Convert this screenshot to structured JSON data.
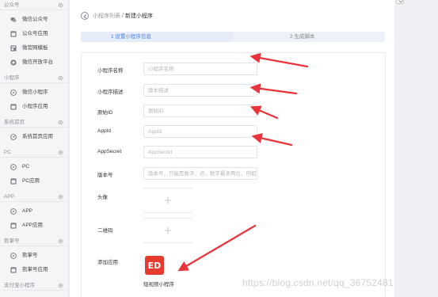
{
  "sidebar": {
    "groups": [
      {
        "title": "公众号",
        "items": [
          {
            "label": "微信公众号",
            "icon": "chat-bubble-icon"
          },
          {
            "label": "公众号应用",
            "icon": "app-window-icon"
          },
          {
            "label": "微官网模板",
            "icon": "template-icon"
          },
          {
            "label": "微信开放平台",
            "icon": "platform-icon"
          }
        ]
      },
      {
        "title": "小程序",
        "items": [
          {
            "label": "微信小程序",
            "icon": "compass-icon"
          },
          {
            "label": "小程序应用",
            "icon": "app-window-icon"
          }
        ]
      },
      {
        "title": "系统首页",
        "items": [
          {
            "label": "系统首页应用",
            "icon": "gauge-icon"
          }
        ]
      },
      {
        "title": "PC",
        "items": [
          {
            "label": "PC",
            "icon": "compass-icon"
          },
          {
            "label": "PC应用",
            "icon": "app-window-icon"
          }
        ]
      },
      {
        "title": "APP",
        "items": [
          {
            "label": "APP",
            "icon": "compass-icon"
          },
          {
            "label": "APP应用",
            "icon": "app-window-icon"
          }
        ]
      },
      {
        "title": "熊掌号",
        "items": [
          {
            "label": "熊掌号",
            "icon": "compass-icon"
          },
          {
            "label": "熊掌号应用",
            "icon": "app-window-icon"
          }
        ]
      },
      {
        "title": "支付宝小程序",
        "items": []
      }
    ]
  },
  "breadcrumb": {
    "list": "小程序列表",
    "separator": "/",
    "current": "新建小程序"
  },
  "steps": [
    {
      "label": "1 设置小程序信息",
      "active": true
    },
    {
      "label": "2 生成脚本",
      "active": false
    }
  ],
  "form": {
    "name": {
      "label": "小程序名称",
      "placeholder": "小程序名称",
      "value": ""
    },
    "desc": {
      "label": "小程序描述",
      "placeholder": "版本描述",
      "value": ""
    },
    "origin_id": {
      "label": "原始ID",
      "placeholder": "原始ID",
      "value": ""
    },
    "appid": {
      "label": "AppId",
      "placeholder": "AppId",
      "value": ""
    },
    "appsecret": {
      "label": "AppSecret",
      "placeholder": "AppSecret",
      "value": ""
    },
    "version": {
      "label": "版本号",
      "placeholder": "版本号，只能是数字、点，数字最多两位，例如 1.1.1 或者1.2",
      "value": ""
    },
    "avatar": {
      "label": "头像"
    },
    "qrcode": {
      "label": "二维码"
    },
    "add_app": {
      "label": "添加应用",
      "app_name": "短视频小程序",
      "app_logo_text": "ED"
    }
  },
  "watermark": "https://blog.csdn.net/qq_36752481",
  "colors": {
    "accent": "#4a7de0",
    "arrow": "#e8343a",
    "app_tile": "#e63b2e"
  }
}
